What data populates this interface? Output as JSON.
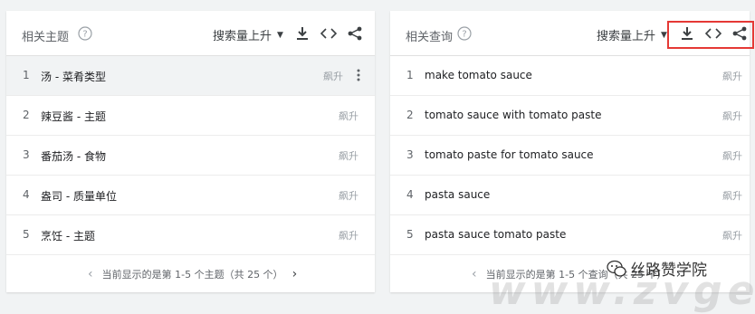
{
  "left_panel": {
    "title": "相关主题",
    "sort_label": "搜索量上升",
    "rows": [
      {
        "rank": "1",
        "label": "汤 - 菜肴类型",
        "surge": "飙升"
      },
      {
        "rank": "2",
        "label": "辣豆酱 - 主题",
        "surge": "飙升"
      },
      {
        "rank": "3",
        "label": "番茄汤 - 食物",
        "surge": "飙升"
      },
      {
        "rank": "4",
        "label": "盎司 - 质量单位",
        "surge": "飙升"
      },
      {
        "rank": "5",
        "label": "烹饪 - 主题",
        "surge": "飙升"
      }
    ],
    "pagination": "当前显示的是第 1-5 个主题（共 25 个）"
  },
  "right_panel": {
    "title": "相关查询",
    "sort_label": "搜索量上升",
    "rows": [
      {
        "rank": "1",
        "label": "make tomato sauce",
        "surge": "飙升"
      },
      {
        "rank": "2",
        "label": "tomato sauce with tomato paste",
        "surge": "飙升"
      },
      {
        "rank": "3",
        "label": "tomato paste for tomato sauce",
        "surge": "飙升"
      },
      {
        "rank": "4",
        "label": "pasta sauce",
        "surge": "飙升"
      },
      {
        "rank": "5",
        "label": "pasta sauce tomato paste",
        "surge": "飙升"
      }
    ],
    "pagination": "当前显示的是第 1-5 个查询（共 25 个）"
  },
  "icons": {
    "help": "help-circle-icon",
    "download": "download-icon",
    "embed": "code-icon",
    "share": "share-icon",
    "more": "more-vert-icon",
    "prev": "chevron-left-icon",
    "next": "chevron-right-icon"
  },
  "watermark": {
    "name": "丝路赞学院",
    "url": "www.zvge.cn"
  },
  "colors": {
    "highlight_border": "#e53935",
    "surge_text": "#9aa0a6",
    "background": "#f1f3f4"
  }
}
